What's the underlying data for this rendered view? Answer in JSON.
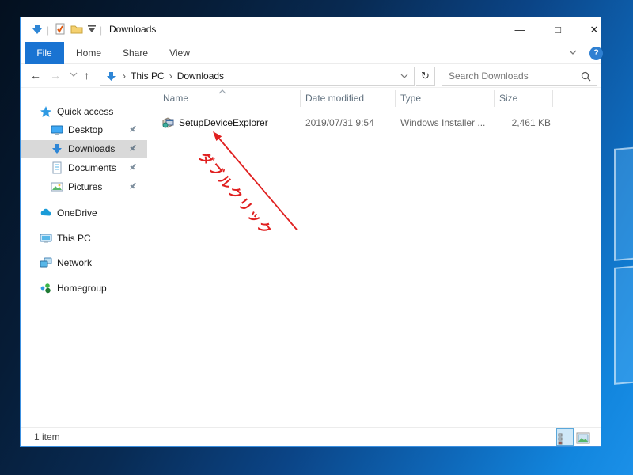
{
  "window": {
    "title": "Downloads",
    "controls": {
      "minimize": "—",
      "maximize": "□",
      "close": "✕"
    }
  },
  "ribbon": {
    "tabs": [
      {
        "label": "File"
      },
      {
        "label": "Home"
      },
      {
        "label": "Share"
      },
      {
        "label": "View"
      }
    ],
    "help_label": "?"
  },
  "nav": {
    "back_glyph": "←",
    "forward_glyph": "→",
    "up_glyph": "↑",
    "refresh_glyph": "↻",
    "breadcrumb": [
      "This PC",
      "Downloads"
    ],
    "separator": "›",
    "search_placeholder": "Search Downloads"
  },
  "sidebar": {
    "quick_access_label": "Quick access",
    "pinned": [
      {
        "label": "Desktop"
      },
      {
        "label": "Downloads",
        "selected": true
      },
      {
        "label": "Documents"
      },
      {
        "label": "Pictures"
      }
    ],
    "roots": [
      {
        "label": "OneDrive"
      },
      {
        "label": "This PC"
      },
      {
        "label": "Network"
      },
      {
        "label": "Homegroup"
      }
    ]
  },
  "file_list": {
    "columns": [
      "Name",
      "Date modified",
      "Type",
      "Size"
    ],
    "sort": {
      "column": "Name",
      "direction": "ascending"
    },
    "rows": [
      {
        "name": "SetupDeviceExplorer",
        "date_modified": "2019/07/31 9:54",
        "type": "Windows Installer ...",
        "size": "2,461 KB",
        "icon": "msi-installer-icon"
      }
    ]
  },
  "annotation": {
    "text": "ダブルクリック",
    "color": "#e02020"
  },
  "status_bar": {
    "count": "1 item"
  },
  "colors": {
    "accent_blue": "#1973d2",
    "selection_gray": "#d9d9d9",
    "annotation_red": "#e02020",
    "desktop_blue": "#0f7ad0",
    "window_border": "#3c90e0"
  }
}
